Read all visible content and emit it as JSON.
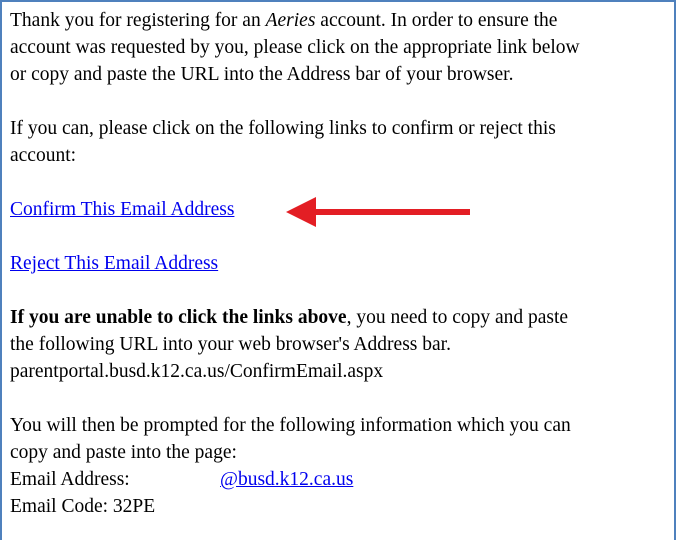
{
  "colors": {
    "frame_border": "#4f81bd",
    "link": "#0000ee",
    "arrow": "#e31e24"
  },
  "intro": {
    "part1": "Thank you for registering for an ",
    "brand": "Aeries",
    "part2": " account. In order to ensure the",
    "line2": "account was requested by you, please click on the appropriate link below",
    "line3": "or copy and paste the URL into the Address bar of your browser."
  },
  "links_intro": {
    "line1": "If you can, please click on the following links to confirm or reject this",
    "line2": "account:"
  },
  "links": {
    "confirm": "Confirm This Email Address",
    "reject": "Reject This Email Address"
  },
  "arrow_icon": "left-arrow-icon",
  "unable": {
    "bold": "If you are unable to click the links above",
    "rest": ", you need to copy and paste",
    "line2": "the following URL into your web browser's Address bar.",
    "url": "parentportal.busd.k12.ca.us/ConfirmEmail.aspx"
  },
  "prompt": {
    "line1": "You will then be prompted for the following information which you can",
    "line2": "copy and paste into the page:",
    "email_label": "Email Address:",
    "email_value": "@busd.k12.ca.us",
    "code_label": "Email Code:",
    "code_value": "32PE"
  }
}
